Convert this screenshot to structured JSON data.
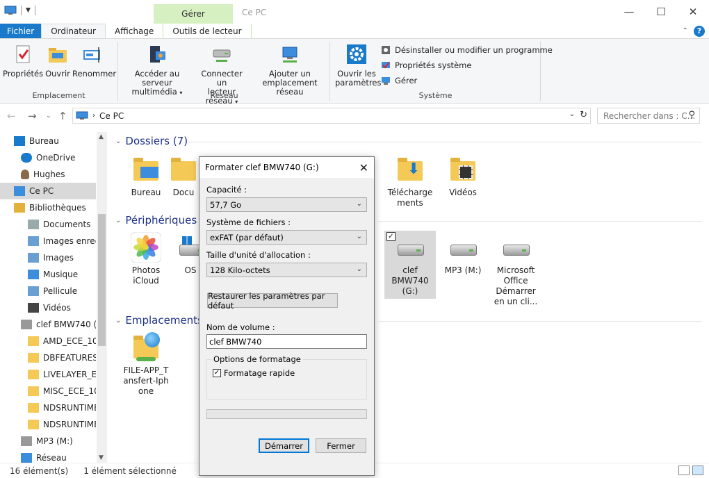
{
  "titlebar": {
    "context_tab": "Gérer",
    "title": "Ce PC",
    "minimize": "—",
    "maximize": "☐",
    "close": "✕"
  },
  "tabs": {
    "file": "Fichier",
    "computer": "Ordinateur",
    "view": "Affichage",
    "drive_tools": "Outils de lecteur"
  },
  "ribbon": {
    "location": {
      "label": "Emplacement",
      "properties": "Propriétés",
      "open": "Ouvrir",
      "rename": "Renommer"
    },
    "network": {
      "label": "Réseau",
      "media_server_line1": "Accéder au serveur",
      "media_server_line2": "multimédia",
      "map_drive_line1": "Connecter un",
      "map_drive_line2": "lecteur réseau",
      "add_location_line1": "Ajouter un",
      "add_location_line2": "emplacement réseau"
    },
    "system": {
      "label": "Système",
      "settings_line1": "Ouvrir les",
      "settings_line2": "paramètres",
      "uninstall": "Désinstaller ou modifier un programme",
      "system_properties": "Propriétés système",
      "manage": "Gérer"
    }
  },
  "address": {
    "path": "Ce PC",
    "search_placeholder": "Rechercher dans : C..."
  },
  "nav": {
    "items": [
      "Bureau",
      "OneDrive",
      "Hughes",
      "Ce PC",
      "Bibliothèques",
      "Documents",
      "Images enregis",
      "Images",
      "Musique",
      "Pellicule",
      "Vidéos",
      "clef BMW740 (G:",
      "AMD_ECE_1010",
      "DBFEATURES_E",
      "LIVELAYER_ECE",
      "MISC_ECE_1010",
      "NDSRUNTIME_",
      "NDSRUNTIME_",
      "MP3 (M:)",
      "Réseau"
    ]
  },
  "content": {
    "folders_header": "Dossiers (7)",
    "devices_header": "Périphériques et",
    "network_header": "Emplacements r",
    "folders": [
      "Bureau",
      "Docu",
      "Télécharge ments",
      "Vidéos"
    ],
    "devices": [
      "Photos iCloud",
      "OS",
      "clef BMW740 (G:)",
      "MP3 (M:)",
      "Microsoft Office Démarrer en un cli..."
    ],
    "network": [
      "FILE-APP_T ansfert-Iph one"
    ]
  },
  "status": {
    "count": "16 élément(s)",
    "selected": "1 élément sélectionné"
  },
  "dialog": {
    "title": "Formater clef BMW740 (G:)",
    "capacity_label": "Capacité :",
    "capacity_value": "57,7 Go",
    "fs_label": "Système de fichiers :",
    "fs_value": "exFAT (par défaut)",
    "alloc_label": "Taille d'unité d'allocation :",
    "alloc_value": "128 Kilo-octets",
    "restore_button": "Restaurer les paramètres par défaut",
    "volume_label": "Nom de volume :",
    "volume_value": "clef BMW740",
    "options_legend": "Options de formatage",
    "quick_format": "Formatage rapide",
    "start_button": "Démarrer",
    "close_button": "Fermer",
    "progress": 0
  },
  "colors": {
    "accent": "#1979ca",
    "context_tab": "#d7f0c2",
    "section_header": "#1e3287",
    "selection": "#d9d9d9"
  }
}
